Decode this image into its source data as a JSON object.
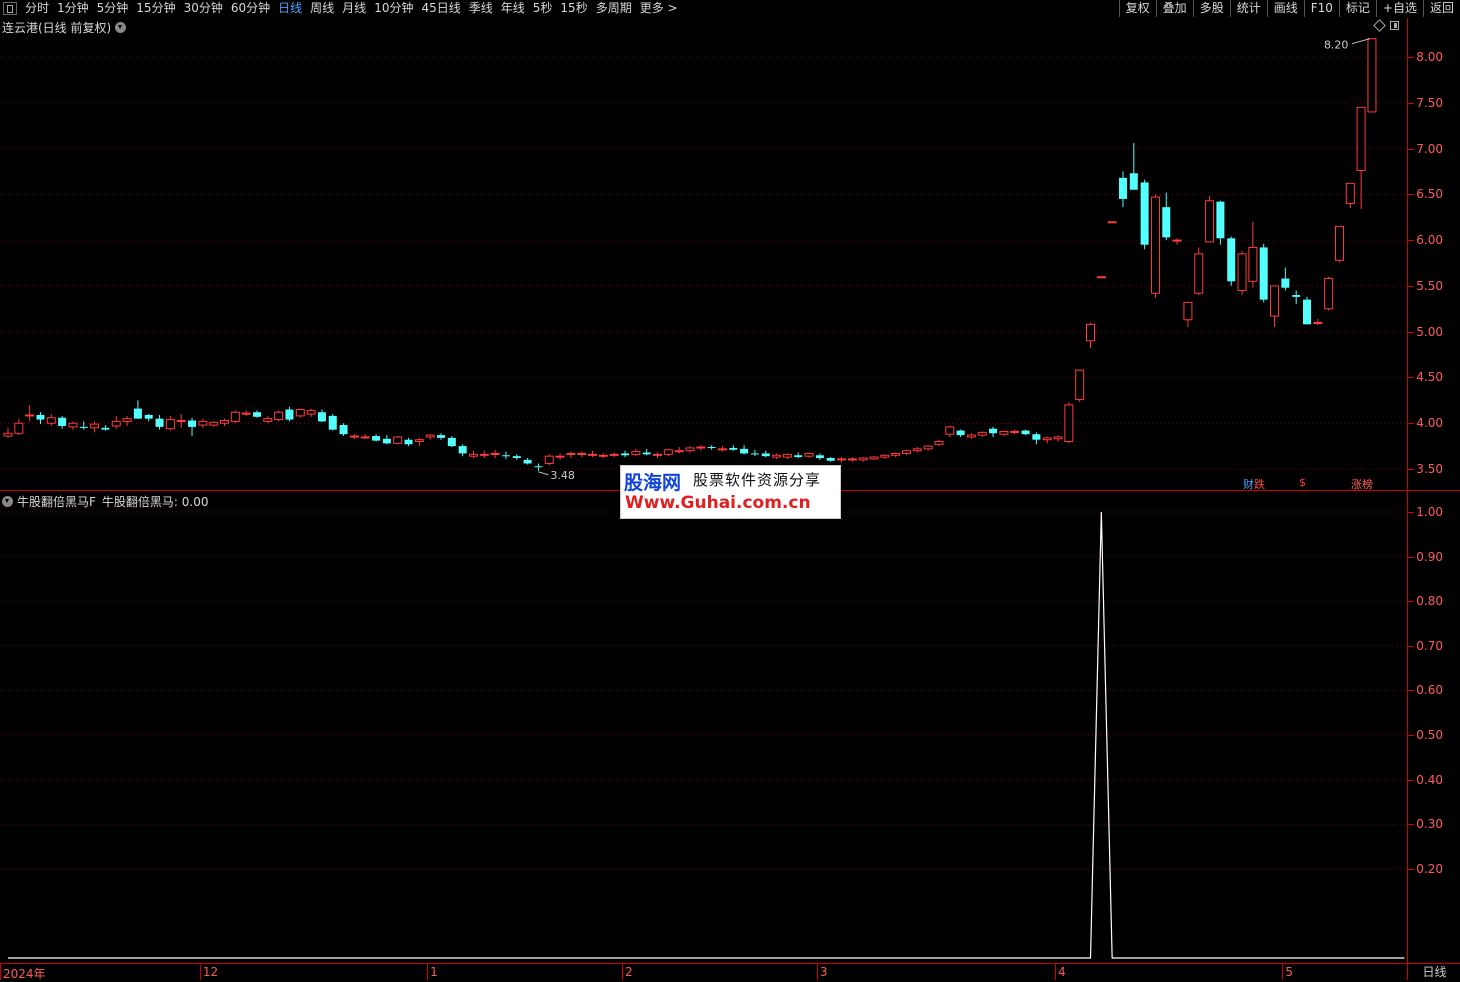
{
  "toolbar": {
    "periods": [
      "分时",
      "1分钟",
      "5分钟",
      "15分钟",
      "30分钟",
      "60分钟",
      "日线",
      "周线",
      "月线",
      "10分钟",
      "45日线",
      "季线",
      "年线",
      "5秒",
      "15秒",
      "多周期",
      "更多 >"
    ],
    "active_period": "日线",
    "right_buttons": [
      "复权",
      "叠加",
      "多股",
      "统计",
      "画线",
      "F10",
      "标记",
      "+自选",
      "返回"
    ]
  },
  "main_panel": {
    "title": "连云港(日线 前复权)",
    "price_axis": [
      "8.00",
      "7.50",
      "7.00",
      "6.50",
      "6.00",
      "5.50",
      "5.00",
      "4.50",
      "4.00",
      "3.50"
    ],
    "high_label": "8.20",
    "low_label": "3.48",
    "markers": {
      "caiji_a": "财",
      "caiji_b": "跌",
      "dollar": "$",
      "zhangting": "涨榜"
    }
  },
  "indicator_panel": {
    "title": "牛股翻倍黑马F",
    "value_label": "牛股翻倍黑马: 0.00",
    "axis": [
      "1.00",
      "0.90",
      "0.80",
      "0.70",
      "0.60",
      "0.50",
      "0.40",
      "0.30",
      "0.20"
    ]
  },
  "time_axis": {
    "labels": [
      "2024年",
      "12",
      "1",
      "2",
      "3",
      "4",
      "5"
    ],
    "period": "日线"
  },
  "watermark": {
    "name": "股海网",
    "slogan": "股票软件资源分享",
    "url": "Www.Guhai.com.cn"
  },
  "colors": {
    "up": "#ff3b3b",
    "down": "#54ffff",
    "grid": "#800000",
    "axis": "#cc0000",
    "signal": "#ffffff",
    "active_period": "#4fa3ff"
  },
  "chart_data": [
    {
      "type": "candlestick",
      "title": "连云港(日线 前复权)",
      "ylim": [
        3.3,
        8.4
      ],
      "ohlc": [
        [
          3.86,
          3.95,
          3.84,
          3.89
        ],
        [
          3.89,
          4.05,
          3.87,
          4.0
        ],
        [
          4.08,
          4.2,
          4.02,
          4.09
        ],
        [
          4.09,
          4.12,
          3.99,
          4.04
        ],
        [
          4.0,
          4.1,
          3.97,
          4.06
        ],
        [
          4.06,
          4.08,
          3.94,
          3.97
        ],
        [
          3.96,
          4.02,
          3.93,
          4.0
        ],
        [
          3.96,
          4.02,
          3.93,
          3.95
        ],
        [
          3.95,
          4.02,
          3.9,
          3.99
        ],
        [
          3.95,
          3.98,
          3.92,
          3.93
        ],
        [
          3.97,
          4.08,
          3.94,
          4.02
        ],
        [
          4.02,
          4.08,
          3.97,
          4.05
        ],
        [
          4.16,
          4.25,
          4.05,
          4.05
        ],
        [
          4.09,
          4.1,
          4.02,
          4.05
        ],
        [
          4.05,
          4.09,
          3.93,
          3.96
        ],
        [
          3.94,
          4.08,
          3.92,
          4.04
        ],
        [
          4.02,
          4.1,
          3.95,
          4.03
        ],
        [
          4.03,
          4.06,
          3.86,
          3.96
        ],
        [
          3.98,
          4.05,
          3.95,
          4.02
        ],
        [
          3.98,
          4.02,
          3.96,
          4.01
        ],
        [
          4.0,
          4.05,
          3.97,
          4.03
        ],
        [
          4.02,
          4.14,
          4.0,
          4.12
        ],
        [
          4.1,
          4.14,
          4.08,
          4.11
        ],
        [
          4.12,
          4.14,
          4.06,
          4.07
        ],
        [
          4.02,
          4.08,
          4.0,
          4.05
        ],
        [
          4.04,
          4.14,
          4.02,
          4.12
        ],
        [
          4.15,
          4.18,
          4.02,
          4.04
        ],
        [
          4.08,
          4.16,
          4.06,
          4.15
        ],
        [
          4.1,
          4.16,
          4.07,
          4.14
        ],
        [
          4.12,
          4.15,
          4.01,
          4.02
        ],
        [
          4.08,
          4.1,
          3.92,
          3.93
        ],
        [
          3.98,
          4.0,
          3.86,
          3.88
        ],
        [
          3.85,
          3.88,
          3.83,
          3.86
        ],
        [
          3.85,
          3.88,
          3.83,
          3.85
        ],
        [
          3.86,
          3.88,
          3.8,
          3.81
        ],
        [
          3.83,
          3.87,
          3.77,
          3.78
        ],
        [
          3.78,
          3.86,
          3.77,
          3.85
        ],
        [
          3.82,
          3.84,
          3.75,
          3.77
        ],
        [
          3.8,
          3.84,
          3.75,
          3.82
        ],
        [
          3.85,
          3.88,
          3.82,
          3.87
        ],
        [
          3.87,
          3.89,
          3.82,
          3.84
        ],
        [
          3.84,
          3.86,
          3.74,
          3.75
        ],
        [
          3.75,
          3.77,
          3.64,
          3.67
        ],
        [
          3.64,
          3.7,
          3.62,
          3.66
        ],
        [
          3.66,
          3.7,
          3.62,
          3.66
        ],
        [
          3.66,
          3.71,
          3.62,
          3.67
        ],
        [
          3.65,
          3.69,
          3.61,
          3.64
        ],
        [
          3.64,
          3.66,
          3.6,
          3.62
        ],
        [
          3.6,
          3.62,
          3.55,
          3.56
        ],
        [
          3.53,
          3.56,
          3.48,
          3.52
        ],
        [
          3.56,
          3.66,
          3.54,
          3.64
        ],
        [
          3.63,
          3.67,
          3.6,
          3.64
        ],
        [
          3.66,
          3.69,
          3.62,
          3.67
        ],
        [
          3.67,
          3.69,
          3.63,
          3.67
        ],
        [
          3.66,
          3.7,
          3.63,
          3.66
        ],
        [
          3.64,
          3.67,
          3.62,
          3.65
        ],
        [
          3.65,
          3.68,
          3.63,
          3.66
        ],
        [
          3.67,
          3.7,
          3.63,
          3.65
        ],
        [
          3.66,
          3.72,
          3.64,
          3.69
        ],
        [
          3.68,
          3.72,
          3.65,
          3.66
        ],
        [
          3.65,
          3.68,
          3.62,
          3.66
        ],
        [
          3.66,
          3.72,
          3.64,
          3.71
        ],
        [
          3.7,
          3.74,
          3.67,
          3.7
        ],
        [
          3.7,
          3.75,
          3.68,
          3.73
        ],
        [
          3.73,
          3.76,
          3.7,
          3.74
        ],
        [
          3.74,
          3.76,
          3.71,
          3.73
        ],
        [
          3.72,
          3.75,
          3.69,
          3.72
        ],
        [
          3.73,
          3.76,
          3.7,
          3.71
        ],
        [
          3.72,
          3.76,
          3.66,
          3.67
        ],
        [
          3.67,
          3.71,
          3.64,
          3.66
        ],
        [
          3.67,
          3.7,
          3.63,
          3.64
        ],
        [
          3.63,
          3.67,
          3.61,
          3.65
        ],
        [
          3.63,
          3.67,
          3.61,
          3.66
        ],
        [
          3.65,
          3.68,
          3.62,
          3.63
        ],
        [
          3.64,
          3.68,
          3.62,
          3.67
        ],
        [
          3.65,
          3.67,
          3.6,
          3.62
        ],
        [
          3.62,
          3.63,
          3.58,
          3.59
        ],
        [
          3.6,
          3.63,
          3.57,
          3.61
        ],
        [
          3.6,
          3.63,
          3.58,
          3.61
        ],
        [
          3.6,
          3.63,
          3.58,
          3.62
        ],
        [
          3.61,
          3.64,
          3.6,
          3.63
        ],
        [
          3.63,
          3.66,
          3.61,
          3.65
        ],
        [
          3.65,
          3.68,
          3.63,
          3.67
        ],
        [
          3.67,
          3.71,
          3.65,
          3.7
        ],
        [
          3.7,
          3.74,
          3.68,
          3.72
        ],
        [
          3.72,
          3.76,
          3.7,
          3.75
        ],
        [
          3.77,
          3.82,
          3.75,
          3.8
        ],
        [
          3.88,
          3.97,
          3.85,
          3.96
        ],
        [
          3.92,
          3.93,
          3.85,
          3.87
        ],
        [
          3.85,
          3.89,
          3.83,
          3.87
        ],
        [
          3.87,
          3.91,
          3.85,
          3.9
        ],
        [
          3.94,
          3.96,
          3.85,
          3.89
        ],
        [
          3.88,
          3.92,
          3.86,
          3.91
        ],
        [
          3.9,
          3.93,
          3.88,
          3.91
        ],
        [
          3.92,
          3.93,
          3.87,
          3.88
        ],
        [
          3.88,
          3.9,
          3.77,
          3.82
        ],
        [
          3.82,
          3.85,
          3.78,
          3.84
        ],
        [
          3.83,
          3.87,
          3.8,
          3.85
        ],
        [
          3.8,
          4.23,
          3.78,
          4.2
        ],
        [
          4.26,
          4.58,
          4.23,
          4.58
        ],
        [
          4.9,
          5.1,
          4.82,
          5.08
        ],
        [
          5.6,
          5.6,
          5.6,
          5.6
        ],
        [
          6.2,
          6.2,
          6.2,
          6.2
        ],
        [
          6.68,
          6.75,
          6.36,
          6.45
        ],
        [
          6.73,
          7.06,
          6.6,
          6.55
        ],
        [
          6.63,
          6.66,
          5.9,
          5.95
        ],
        [
          5.42,
          6.5,
          5.37,
          6.47
        ],
        [
          6.36,
          6.52,
          6.0,
          6.03
        ],
        [
          6.0,
          6.02,
          5.95,
          6.0
        ],
        [
          5.13,
          5.25,
          5.05,
          5.32
        ],
        [
          5.42,
          5.92,
          5.4,
          5.85
        ],
        [
          5.98,
          6.48,
          5.98,
          6.43
        ],
        [
          6.42,
          6.43,
          5.95,
          6.02
        ],
        [
          6.02,
          6.04,
          5.5,
          5.55
        ],
        [
          5.45,
          5.88,
          5.4,
          5.85
        ],
        [
          5.55,
          6.2,
          5.48,
          5.92
        ],
        [
          5.92,
          5.96,
          5.32,
          5.35
        ],
        [
          5.17,
          5.5,
          5.05,
          5.5
        ],
        [
          5.58,
          5.7,
          5.45,
          5.48
        ],
        [
          5.4,
          5.45,
          5.3,
          5.38
        ],
        [
          5.35,
          5.38,
          5.1,
          5.08
        ],
        [
          5.1,
          5.14,
          5.07,
          5.1
        ],
        [
          5.25,
          5.6,
          5.23,
          5.58
        ],
        [
          5.78,
          6.15,
          5.76,
          6.15
        ],
        [
          6.4,
          6.58,
          6.35,
          6.62
        ],
        [
          6.76,
          7.45,
          6.34,
          7.45
        ],
        [
          7.4,
          8.2,
          7.4,
          8.2
        ]
      ]
    },
    {
      "type": "line",
      "title": "牛股翻倍黑马F",
      "series": [
        {
          "name": "牛股翻倍黑马",
          "values": [
            0,
            0,
            0,
            0,
            0,
            0,
            0,
            0,
            0,
            0,
            0,
            0,
            0,
            0,
            0,
            0,
            0,
            0,
            0,
            0,
            0,
            0,
            0,
            0,
            0,
            0,
            0,
            0,
            0,
            0,
            0,
            0,
            0,
            0,
            0,
            0,
            0,
            0,
            0,
            0,
            0,
            0,
            0,
            0,
            0,
            0,
            0,
            0,
            0,
            0,
            0,
            0,
            0,
            0,
            0,
            0,
            0,
            0,
            0,
            0,
            0,
            0,
            0,
            0,
            0,
            0,
            0,
            0,
            0,
            0,
            0,
            0,
            0,
            0,
            0,
            0,
            0,
            0,
            0,
            0,
            0,
            0,
            0,
            0,
            0,
            0,
            0,
            0,
            0,
            0,
            0,
            0,
            0,
            0,
            0,
            0,
            0,
            0,
            0,
            0,
            0,
            1,
            0,
            0,
            0,
            0,
            0,
            0,
            0,
            0,
            0,
            0,
            0,
            0,
            0,
            0,
            0,
            0,
            0,
            0,
            0,
            0,
            0,
            0,
            0,
            0,
            0,
            0,
            0,
            0
          ]
        }
      ],
      "ylim": [
        0.0,
        1.0
      ]
    }
  ]
}
